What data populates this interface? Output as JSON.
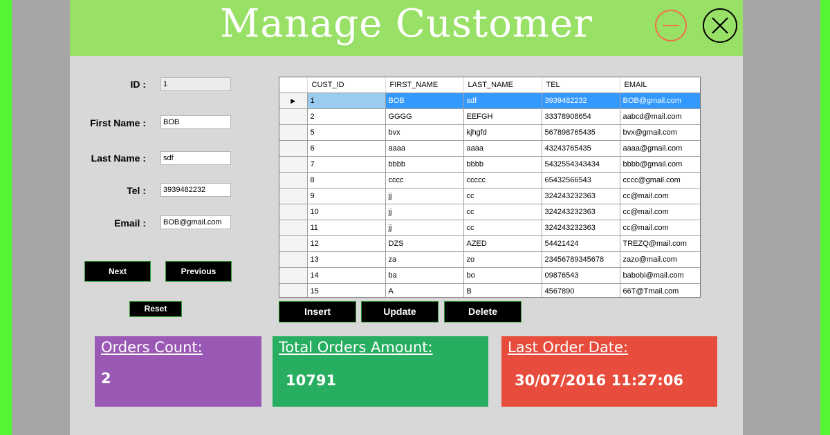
{
  "window": {
    "title": "Manage Customer"
  },
  "form": {
    "id_label": "ID :",
    "id_value": "1",
    "first_name_label": "First Name :",
    "first_name_value": "BOB",
    "last_name_label": "Last Name :",
    "last_name_value": "sdf",
    "tel_label": "Tel :",
    "tel_value": "3939482232",
    "email_label": "Email :",
    "email_value": "BOB@gmail.com",
    "next_label": "Next",
    "previous_label": "Previous",
    "reset_label": "Reset"
  },
  "grid": {
    "columns": [
      "CUST_ID",
      "FIRST_NAME",
      "LAST_NAME",
      "TEL",
      "EMAIL"
    ],
    "selected_row_marker": "▶",
    "rows": [
      [
        "1",
        "BOB",
        "sdf",
        "3939482232",
        "BOB@gmail.com"
      ],
      [
        "2",
        "GGGG",
        "EEFGH",
        "33378908654",
        "aabcd@mail.com"
      ],
      [
        "5",
        "bvx",
        "kjhgfd",
        "567898765435",
        "bvx@gmail.com"
      ],
      [
        "6",
        "aaaa",
        "aaaa",
        "43243765435",
        "aaaa@gmail.com"
      ],
      [
        "7",
        "bbbb",
        "bbbb",
        "5432554343434",
        "bbbb@gmail.com"
      ],
      [
        "8",
        "cccc",
        "ccccc",
        "65432566543",
        "cccc@gmail.com"
      ],
      [
        "9",
        "jj",
        "cc",
        "324243232363",
        "cc@mail.com"
      ],
      [
        "10",
        "jj",
        "cc",
        "324243232363",
        "cc@mail.com"
      ],
      [
        "11",
        "jj",
        "cc",
        "324243232363",
        "cc@mail.com"
      ],
      [
        "12",
        "DZS",
        "AZED",
        "54421424",
        "TREZQ@mail.com"
      ],
      [
        "13",
        "za",
        "zo",
        "23456789345678",
        "zazo@mail.com"
      ],
      [
        "14",
        "ba",
        "bo",
        "09876543",
        "babobi@mail.com"
      ],
      [
        "15",
        "A",
        "B",
        "4567890",
        "66T@Tmail.com"
      ]
    ]
  },
  "actions": {
    "insert_label": "Insert",
    "update_label": "Update",
    "delete_label": "Delete"
  },
  "stats": {
    "orders_count_title": "Orders Count:",
    "orders_count_value": "2",
    "total_amount_title": "Total Orders Amount:",
    "total_amount_value": "10791",
    "last_order_title": "Last Order Date:",
    "last_order_value": "30/07/2016 11:27:06"
  },
  "colors": {
    "header": "#99e066",
    "card_purple": "#9b59b6",
    "card_green": "#27ae60",
    "card_red": "#e74c3c",
    "selection": "#3399ff"
  }
}
